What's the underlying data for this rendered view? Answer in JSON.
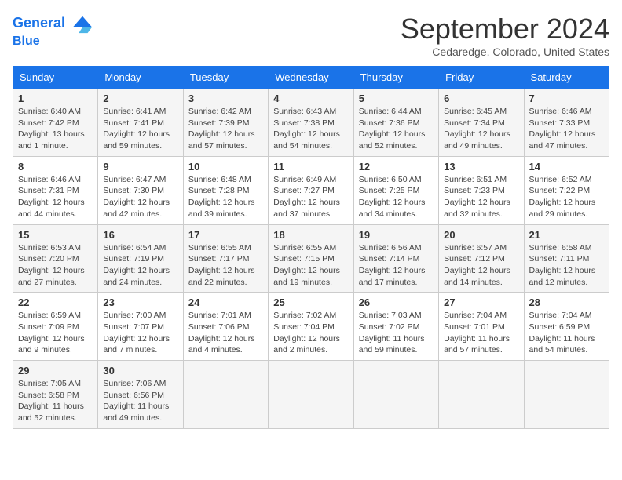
{
  "header": {
    "logo_line1": "General",
    "logo_line2": "Blue",
    "month": "September 2024",
    "location": "Cedaredge, Colorado, United States"
  },
  "weekdays": [
    "Sunday",
    "Monday",
    "Tuesday",
    "Wednesday",
    "Thursday",
    "Friday",
    "Saturday"
  ],
  "weeks": [
    [
      {
        "day": "1",
        "info": "Sunrise: 6:40 AM\nSunset: 7:42 PM\nDaylight: 13 hours\nand 1 minute."
      },
      {
        "day": "2",
        "info": "Sunrise: 6:41 AM\nSunset: 7:41 PM\nDaylight: 12 hours\nand 59 minutes."
      },
      {
        "day": "3",
        "info": "Sunrise: 6:42 AM\nSunset: 7:39 PM\nDaylight: 12 hours\nand 57 minutes."
      },
      {
        "day": "4",
        "info": "Sunrise: 6:43 AM\nSunset: 7:38 PM\nDaylight: 12 hours\nand 54 minutes."
      },
      {
        "day": "5",
        "info": "Sunrise: 6:44 AM\nSunset: 7:36 PM\nDaylight: 12 hours\nand 52 minutes."
      },
      {
        "day": "6",
        "info": "Sunrise: 6:45 AM\nSunset: 7:34 PM\nDaylight: 12 hours\nand 49 minutes."
      },
      {
        "day": "7",
        "info": "Sunrise: 6:46 AM\nSunset: 7:33 PM\nDaylight: 12 hours\nand 47 minutes."
      }
    ],
    [
      {
        "day": "8",
        "info": "Sunrise: 6:46 AM\nSunset: 7:31 PM\nDaylight: 12 hours\nand 44 minutes."
      },
      {
        "day": "9",
        "info": "Sunrise: 6:47 AM\nSunset: 7:30 PM\nDaylight: 12 hours\nand 42 minutes."
      },
      {
        "day": "10",
        "info": "Sunrise: 6:48 AM\nSunset: 7:28 PM\nDaylight: 12 hours\nand 39 minutes."
      },
      {
        "day": "11",
        "info": "Sunrise: 6:49 AM\nSunset: 7:27 PM\nDaylight: 12 hours\nand 37 minutes."
      },
      {
        "day": "12",
        "info": "Sunrise: 6:50 AM\nSunset: 7:25 PM\nDaylight: 12 hours\nand 34 minutes."
      },
      {
        "day": "13",
        "info": "Sunrise: 6:51 AM\nSunset: 7:23 PM\nDaylight: 12 hours\nand 32 minutes."
      },
      {
        "day": "14",
        "info": "Sunrise: 6:52 AM\nSunset: 7:22 PM\nDaylight: 12 hours\nand 29 minutes."
      }
    ],
    [
      {
        "day": "15",
        "info": "Sunrise: 6:53 AM\nSunset: 7:20 PM\nDaylight: 12 hours\nand 27 minutes."
      },
      {
        "day": "16",
        "info": "Sunrise: 6:54 AM\nSunset: 7:19 PM\nDaylight: 12 hours\nand 24 minutes."
      },
      {
        "day": "17",
        "info": "Sunrise: 6:55 AM\nSunset: 7:17 PM\nDaylight: 12 hours\nand 22 minutes."
      },
      {
        "day": "18",
        "info": "Sunrise: 6:55 AM\nSunset: 7:15 PM\nDaylight: 12 hours\nand 19 minutes."
      },
      {
        "day": "19",
        "info": "Sunrise: 6:56 AM\nSunset: 7:14 PM\nDaylight: 12 hours\nand 17 minutes."
      },
      {
        "day": "20",
        "info": "Sunrise: 6:57 AM\nSunset: 7:12 PM\nDaylight: 12 hours\nand 14 minutes."
      },
      {
        "day": "21",
        "info": "Sunrise: 6:58 AM\nSunset: 7:11 PM\nDaylight: 12 hours\nand 12 minutes."
      }
    ],
    [
      {
        "day": "22",
        "info": "Sunrise: 6:59 AM\nSunset: 7:09 PM\nDaylight: 12 hours\nand 9 minutes."
      },
      {
        "day": "23",
        "info": "Sunrise: 7:00 AM\nSunset: 7:07 PM\nDaylight: 12 hours\nand 7 minutes."
      },
      {
        "day": "24",
        "info": "Sunrise: 7:01 AM\nSunset: 7:06 PM\nDaylight: 12 hours\nand 4 minutes."
      },
      {
        "day": "25",
        "info": "Sunrise: 7:02 AM\nSunset: 7:04 PM\nDaylight: 12 hours\nand 2 minutes."
      },
      {
        "day": "26",
        "info": "Sunrise: 7:03 AM\nSunset: 7:02 PM\nDaylight: 11 hours\nand 59 minutes."
      },
      {
        "day": "27",
        "info": "Sunrise: 7:04 AM\nSunset: 7:01 PM\nDaylight: 11 hours\nand 57 minutes."
      },
      {
        "day": "28",
        "info": "Sunrise: 7:04 AM\nSunset: 6:59 PM\nDaylight: 11 hours\nand 54 minutes."
      }
    ],
    [
      {
        "day": "29",
        "info": "Sunrise: 7:05 AM\nSunset: 6:58 PM\nDaylight: 11 hours\nand 52 minutes."
      },
      {
        "day": "30",
        "info": "Sunrise: 7:06 AM\nSunset: 6:56 PM\nDaylight: 11 hours\nand 49 minutes."
      },
      {
        "day": "",
        "info": ""
      },
      {
        "day": "",
        "info": ""
      },
      {
        "day": "",
        "info": ""
      },
      {
        "day": "",
        "info": ""
      },
      {
        "day": "",
        "info": ""
      }
    ]
  ]
}
